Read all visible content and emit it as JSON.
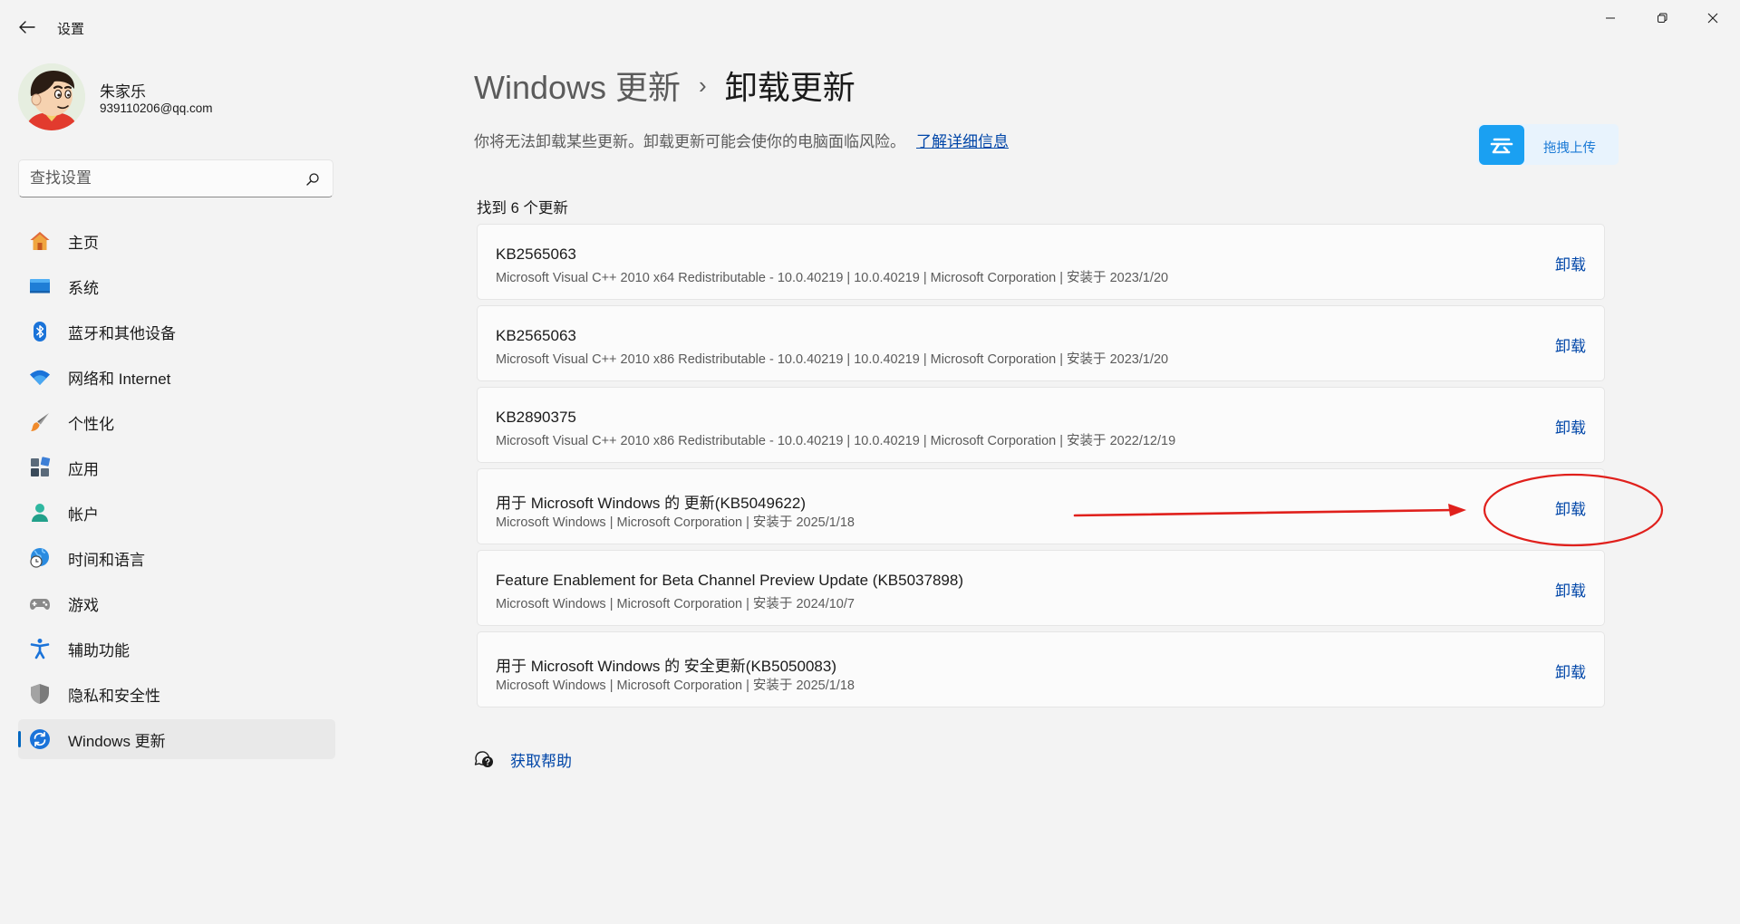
{
  "window": {
    "title": "设置",
    "controls": [
      "minimize-icon",
      "restore-icon",
      "close-icon"
    ]
  },
  "profile": {
    "name": "朱家乐",
    "email": "939110206@qq.com"
  },
  "search": {
    "placeholder": "查找设置",
    "value": ""
  },
  "sidebar": {
    "items": [
      {
        "label": "主页",
        "icon": "home-icon",
        "active": false
      },
      {
        "label": "系统",
        "icon": "system-icon",
        "active": false
      },
      {
        "label": "蓝牙和其他设备",
        "icon": "bluetooth-icon",
        "active": false
      },
      {
        "label": "网络和 Internet",
        "icon": "wifi-icon",
        "active": false
      },
      {
        "label": "个性化",
        "icon": "brush-icon",
        "active": false
      },
      {
        "label": "应用",
        "icon": "apps-icon",
        "active": false
      },
      {
        "label": "帐户",
        "icon": "account-icon",
        "active": false
      },
      {
        "label": "时间和语言",
        "icon": "globe-clock-icon",
        "active": false
      },
      {
        "label": "游戏",
        "icon": "gamepad-icon",
        "active": false
      },
      {
        "label": "辅助功能",
        "icon": "accessibility-icon",
        "active": false
      },
      {
        "label": "隐私和安全性",
        "icon": "shield-icon",
        "active": false
      },
      {
        "label": "Windows 更新",
        "icon": "windows-update-icon",
        "active": true
      }
    ]
  },
  "breadcrumb": {
    "parent": "Windows 更新",
    "separator": "›",
    "current": "卸载更新"
  },
  "description": {
    "text": "你将无法卸载某些更新。卸载更新可能会使你的电脑面临风险。",
    "link": "了解详细信息"
  },
  "upload_widget": {
    "icon_char": "云",
    "label": "拖拽上传"
  },
  "updates": {
    "count_label": "找到 6 个更新",
    "items": [
      {
        "title": "KB2565063",
        "meta": "Microsoft Visual C++ 2010  x64 Redistributable - 10.0.40219  |  10.0.40219  |  Microsoft Corporation  |  安装于 2023/1/20",
        "action": "卸载"
      },
      {
        "title": "KB2565063",
        "meta": "Microsoft Visual C++ 2010  x86 Redistributable - 10.0.40219  |  10.0.40219  |  Microsoft Corporation  |  安装于 2023/1/20",
        "action": "卸载"
      },
      {
        "title": "KB2890375",
        "meta": "Microsoft Visual C++ 2010  x86 Redistributable - 10.0.40219  |  10.0.40219  |  Microsoft Corporation  |  安装于 2022/12/19",
        "action": "卸载"
      },
      {
        "title": "用于 Microsoft Windows 的 更新(KB5049622)",
        "meta": "Microsoft Windows  |  Microsoft Corporation  |  安装于 2025/1/18",
        "action": "卸载"
      },
      {
        "title": "Feature Enablement for Beta Channel Preview Update (KB5037898)",
        "meta": "Microsoft Windows  |  Microsoft Corporation  |  安装于 2024/10/7",
        "action": "卸载"
      },
      {
        "title": "用于 Microsoft Windows 的 安全更新(KB5050083)",
        "meta": "Microsoft Windows  |  Microsoft Corporation  |  安装于 2025/1/18",
        "action": "卸载"
      }
    ]
  },
  "help": {
    "label": "获取帮助"
  },
  "colors": {
    "accent": "#0067c0",
    "link": "#0046a8",
    "annotation": "#e0201c"
  }
}
